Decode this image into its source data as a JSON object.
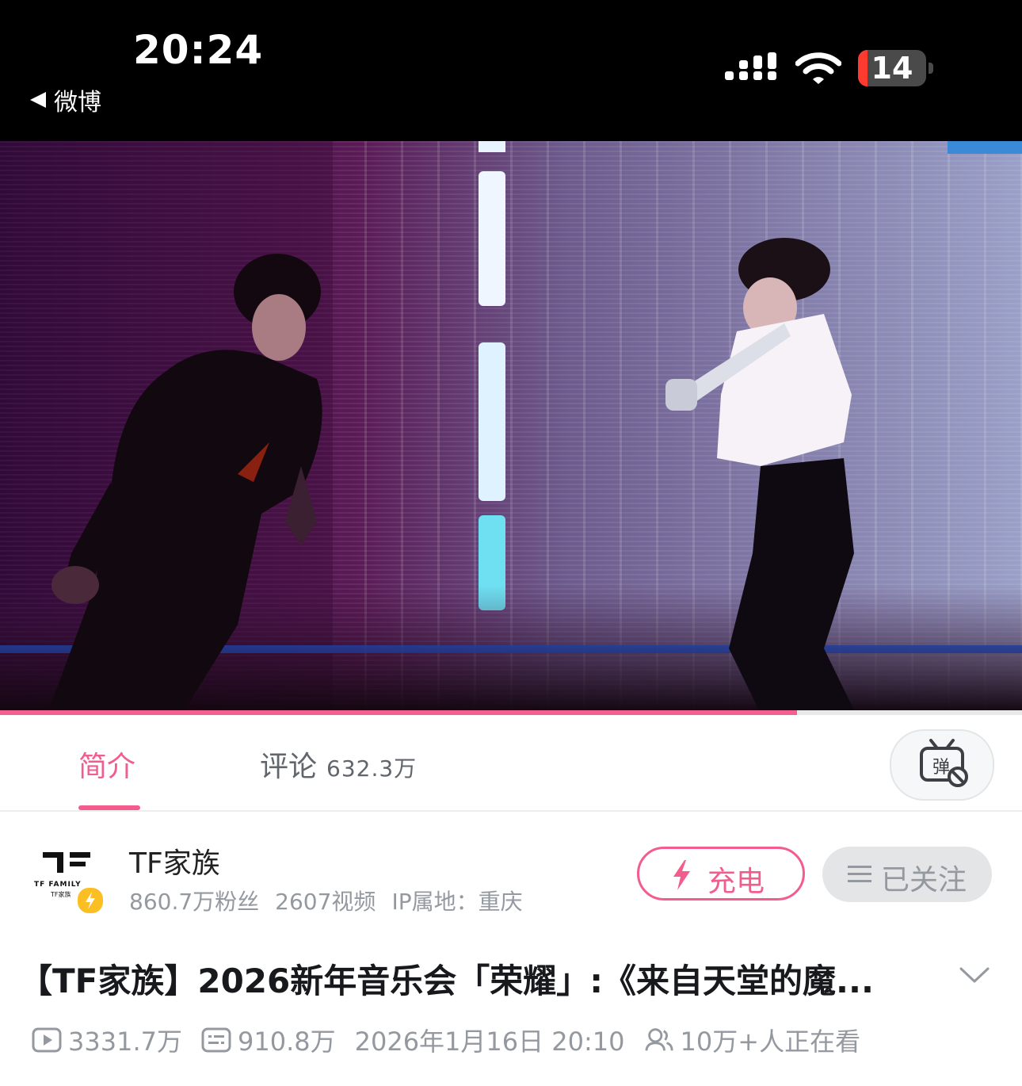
{
  "status_bar": {
    "time": "20:24",
    "back_label": "微博",
    "battery_level": "14",
    "battery_fraction": 0.14
  },
  "video": {
    "progress_fraction": 0.78
  },
  "tabs": {
    "intro_label": "简介",
    "comments_label": "评论",
    "comments_count": "632.3万"
  },
  "uploader": {
    "name": "TF家族",
    "logo_text": "TF FAMILY",
    "logo_sub": "TF家族",
    "fans": "860.7万粉丝",
    "videos": "2607视频",
    "ip_location": "IP属地：重庆",
    "charge_label": "充电",
    "follow_label": "已关注"
  },
  "video_info": {
    "title": "【TF家族】2026新年音乐会「荣耀」:《来自天堂的魔...",
    "views": "3331.7万",
    "danmaku_count": "910.8万",
    "publish_time": "2026年1月16日 20:10",
    "watching_now": "10万+人正在看"
  },
  "colors": {
    "accent_pink": "#f25d8e",
    "muted_gray": "#9499a0"
  }
}
